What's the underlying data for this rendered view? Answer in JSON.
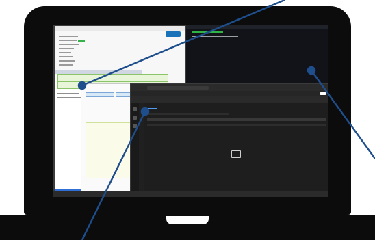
{
  "colors": {
    "laptop_frame": "#0c0c0c",
    "pointer_line": "#1f4e8c",
    "terminal_bg": "#111318",
    "outlook_bg": "#1f1f1f"
  },
  "annotations": [
    {
      "name": "pointer-back-window"
    },
    {
      "name": "pointer-terminal"
    },
    {
      "name": "pointer-outlook"
    }
  ]
}
